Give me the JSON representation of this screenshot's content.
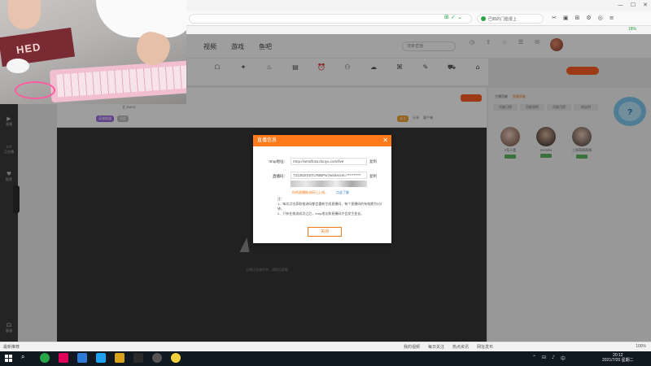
{
  "browser": {
    "search_pill_text": "巴郎的门槛很上",
    "battery": "18%"
  },
  "site": {
    "nav": [
      "视频",
      "游戏",
      "鱼吧"
    ],
    "search_placeholder": "搜索直播"
  },
  "room": {
    "stats": "主 25474",
    "tags": [
      "英雄联盟",
      "回放"
    ],
    "actions": [
      "分享",
      "客户端"
    ],
    "follow": "关注"
  },
  "left_sidebar": {
    "items": [
      "直播",
      "正在播",
      "推荐",
      "客服"
    ]
  },
  "player": {
    "wait_text": "主播正在操作中，请稍后观看"
  },
  "right_panel": {
    "tabs": [
      "主播贡献",
      "直播贡献"
    ],
    "sub_tabs": [
      "贡献日榜",
      "贡献周榜",
      "贡献月榜",
      "粉丝榜"
    ],
    "ranks": [
      "2号人类",
      "DYGEN",
      "三哥哥哥哥哥"
    ]
  },
  "modal": {
    "title": "直播信息",
    "rtmp_label": "rtmp地址：",
    "rtmp_value": "rtmp://sendfc3a.douyu.com/live",
    "code_label": "直播码：",
    "code_value": "731252rSSTu?BBPw?wsSecret=**********",
    "copy_label": "复制",
    "warning": "你的直播推流码已上线，",
    "warning_link": "点此了解",
    "notes_title": "注：",
    "notes": [
      "1、每次点击获取推流码都会重新生成直播码，每个直播码的有效期为5分钟。",
      "2、只有在推流成功之后，rtmp地址和直播码才会发生变化。"
    ],
    "ok_label": "关闭"
  },
  "status_bar": {
    "left": "最新推荐",
    "right_items": [
      "我的视频",
      "每日关注",
      "热点资讯",
      "网址发布"
    ],
    "zoom": "100%"
  },
  "taskbar": {
    "time": "20:12",
    "date": "2021/7/20 星期二"
  }
}
